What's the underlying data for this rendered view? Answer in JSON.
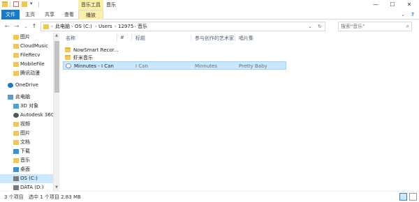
{
  "window": {
    "context_tab": "音乐工具",
    "title": "音乐",
    "minimize_glyph": "—",
    "maximize_glyph": "☐",
    "close_glyph": "✕"
  },
  "ribbon": {
    "file_tab": "文件",
    "tabs": [
      "主页",
      "共享",
      "查看"
    ],
    "context_tab": "播放",
    "help_glyph": "?"
  },
  "nav": {
    "back_glyph": "←",
    "forward_glyph": "→",
    "recent_glyph": "⌄",
    "up_glyph": "↑",
    "path": [
      "此电脑",
      "OS (C:)",
      "Users",
      "12975",
      "音乐"
    ],
    "separator": "›",
    "refresh_glyph": "↻",
    "search_placeholder": "搜索\"音乐\"",
    "search_glyph": "⌕"
  },
  "sidebar": {
    "items": [
      {
        "label": "图片",
        "icon": "pictures-folder-icon",
        "color": "#f4c84e"
      },
      {
        "label": "CloudMusic",
        "icon": "folder-icon",
        "color": "#f4c84e"
      },
      {
        "label": "FileRecv",
        "icon": "folder-icon",
        "color": "#f4c84e"
      },
      {
        "label": "MobileFile",
        "icon": "folder-icon",
        "color": "#f4c84e"
      },
      {
        "label": "腾讯动漫",
        "icon": "folder-icon",
        "color": "#f4c84e"
      },
      {
        "label": "OneDrive",
        "icon": "onedrive-icon",
        "color": "#1979ca"
      },
      {
        "label": "此电脑",
        "icon": "computer-icon",
        "color": "#5a9bd5"
      },
      {
        "label": "3D 对象",
        "icon": "3d-objects-icon",
        "color": "#4aa3df"
      },
      {
        "label": "Autodesk 360",
        "icon": "autodesk-icon",
        "color": "#555555"
      },
      {
        "label": "视频",
        "icon": "videos-icon",
        "color": "#f4c84e"
      },
      {
        "label": "图片",
        "icon": "pictures-icon",
        "color": "#f4c84e"
      },
      {
        "label": "文档",
        "icon": "documents-icon",
        "color": "#f4c84e"
      },
      {
        "label": "下载",
        "icon": "downloads-icon",
        "color": "#3a8fd6"
      },
      {
        "label": "音乐",
        "icon": "music-icon",
        "color": "#f4c84e"
      },
      {
        "label": "桌面",
        "icon": "desktop-icon",
        "color": "#3a8fd6"
      },
      {
        "label": "OS (C:)",
        "icon": "drive-icon",
        "color": "#7a7a7a"
      },
      {
        "label": "DATA (D:)",
        "icon": "drive-icon",
        "color": "#7a7a7a"
      }
    ]
  },
  "columns": [
    "名称",
    "#",
    "标题",
    "参与创作的艺术家",
    "唱片集"
  ],
  "files": [
    {
      "name": "NowSmart Recor...",
      "track": "",
      "title": "",
      "artist": "",
      "album": "",
      "kind": "folder"
    },
    {
      "name": "虾米音乐",
      "track": "",
      "title": "",
      "artist": "",
      "album": "",
      "kind": "folder"
    },
    {
      "name": "Minnutes - I Can",
      "track": "",
      "title": "I Can",
      "artist": "Minnutes",
      "album": "Pretty Baby",
      "kind": "music"
    }
  ],
  "status": {
    "count": "3 个项目",
    "selection": "选中 1 个项目  2.83 MB"
  }
}
